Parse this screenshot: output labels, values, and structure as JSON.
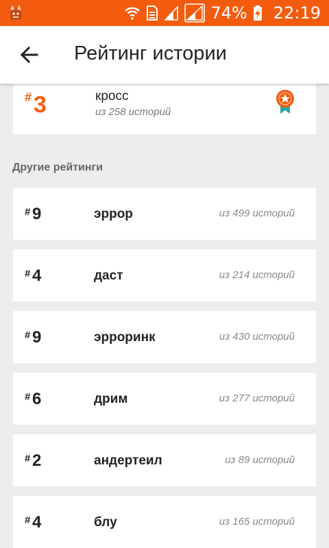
{
  "status_bar": {
    "battery": "74%",
    "time": "22:19"
  },
  "app_bar": {
    "title": "Рейтинг истории"
  },
  "top_rating": {
    "hash": "#",
    "rank": "3",
    "name": "кросс",
    "subtitle": "из 258 историй"
  },
  "section_label": "Другие рейтинги",
  "ratings": [
    {
      "hash": "#",
      "rank": "9",
      "name": "эррор",
      "count": "из 499 историй"
    },
    {
      "hash": "#",
      "rank": "4",
      "name": "даст",
      "count": "из 214 историй"
    },
    {
      "hash": "#",
      "rank": "9",
      "name": "эрроринк",
      "count": "из 430 историй"
    },
    {
      "hash": "#",
      "rank": "6",
      "name": "дрим",
      "count": "из 277 историй"
    },
    {
      "hash": "#",
      "rank": "2",
      "name": "андертеил",
      "count": "из 89 историй"
    },
    {
      "hash": "#",
      "rank": "4",
      "name": "блу",
      "count": "из 165 историй"
    }
  ],
  "colors": {
    "accent": "#f35c0f",
    "background": "#eeecee",
    "medal_teal": "#26a7a5"
  }
}
